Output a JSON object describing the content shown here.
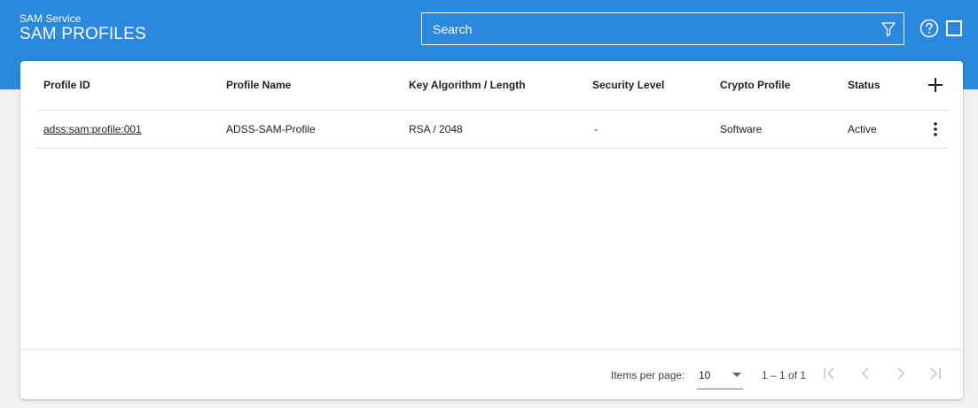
{
  "header": {
    "subtitle": "SAM Service",
    "title": "SAM PROFILES",
    "search_placeholder": "Search",
    "icons": [
      "filter-icon",
      "help-icon",
      "square-icon"
    ],
    "color": "#2a88de"
  },
  "table": {
    "columns": [
      "Profile ID",
      "Profile Name",
      "Key Algorithm / Length",
      "Security Level",
      "Crypto Profile",
      "Status"
    ],
    "rows": [
      {
        "profile_id": "adss:sam:profile:001",
        "profile_name": "ADSS-SAM-Profile",
        "key_algorithm": "RSA / 2048",
        "security_level": "-",
        "crypto_profile": "Software",
        "status": "Active"
      }
    ]
  },
  "paginator": {
    "items_per_page_label": "Items per page:",
    "items_per_page_value": "10",
    "range_label": "1 – 1 of 1"
  }
}
